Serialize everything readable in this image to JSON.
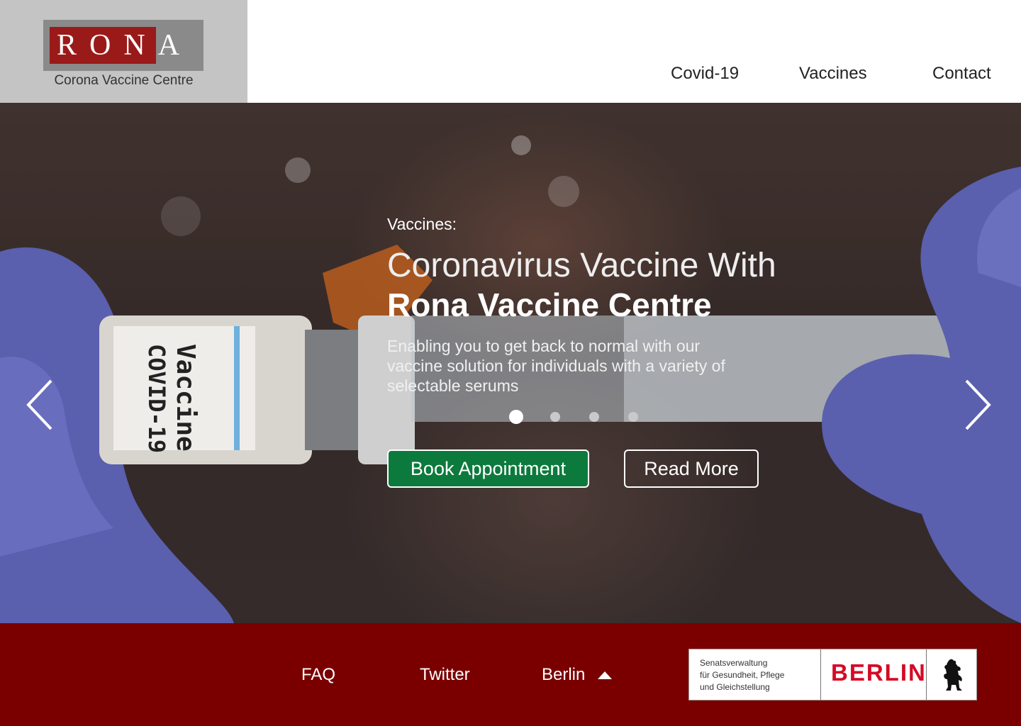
{
  "brand": {
    "logo_text": "RONA",
    "subtitle": "Corona Vaccine Centre",
    "colors": {
      "logo_bg": "#c4c4c4",
      "logo_red": "#9a1a1a"
    }
  },
  "nav": {
    "items": [
      "Covid-19",
      "Vaccines",
      "Contact"
    ]
  },
  "hero": {
    "eyebrow": "Vaccines:",
    "headline_light": "Coronavirus Vaccine With",
    "headline_bold": "Rona Vaccine Centre",
    "description": "Enabling you to get back to normal with our vaccine solution for  individuals with a variety of selectable serums",
    "carousel": {
      "slide_count": 4,
      "active_slide": 1
    },
    "prev_icon": "chevron-left-icon",
    "next_icon": "chevron-right-icon",
    "buttons": {
      "book": "Book Appointment",
      "read_more": "Read More"
    },
    "colors": {
      "book_button": "#0c7a3c"
    }
  },
  "footer": {
    "links": [
      "FAQ",
      "Twitter",
      "Berlin"
    ],
    "berlin_toggle_icon": "triangle-up-icon",
    "badge": {
      "line1": "Senatsverwaltung",
      "line2": "für Gesundheit, Pflege",
      "line3": "und Gleichstellung",
      "wordmark": "BERLIN",
      "emblem_icon": "berlin-bear-icon"
    },
    "colors": {
      "background": "#7a0000",
      "berlin_red": "#d50a25"
    }
  }
}
